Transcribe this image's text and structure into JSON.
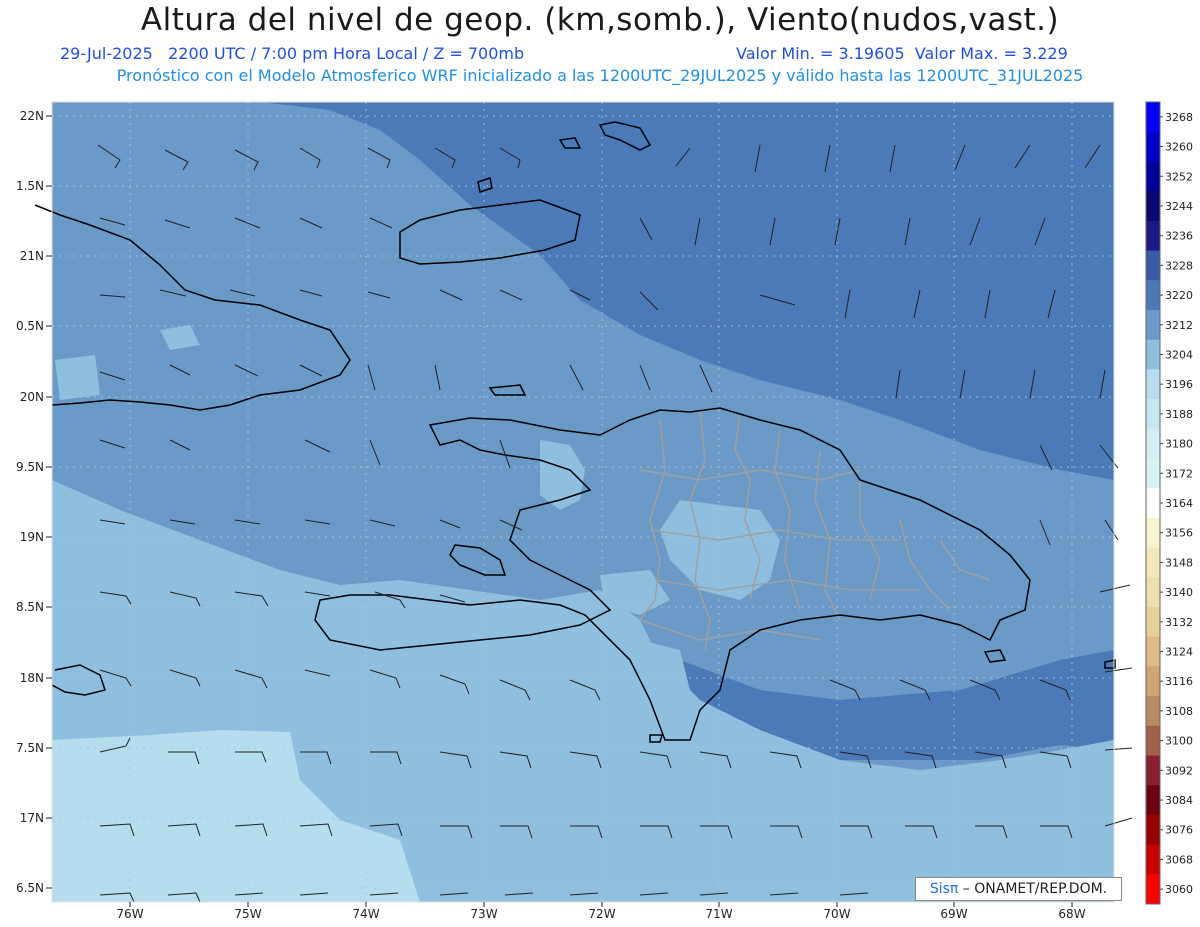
{
  "header": {
    "title": "Altura del nivel de geop. (km,somb.), Viento(nudos,vast.)",
    "run_line": "29-Jul-2025   2200 UTC / 7:00 pm Hora Local / Z = 700mb",
    "minmax_line": "Valor Min. = 3.19605  Valor Max. = 3.229",
    "model_line": "Pronóstico con el Modelo Atmosferico WRF inicializado a las 1200UTC_29JUL2025 y válido hasta las  1200UTC_31JUL2025"
  },
  "axes": {
    "lat_labels": [
      "22N",
      "1.5N",
      "21N",
      "0.5N",
      "20N",
      "9.5N",
      "19N",
      "8.5N",
      "18N",
      "7.5N",
      "17N",
      "6.5N"
    ],
    "lon_labels": [
      "76W",
      "75W",
      "74W",
      "73W",
      "72W",
      "71W",
      "70W",
      "69W",
      "68W"
    ]
  },
  "colorbar": {
    "labels": [
      "3268",
      "3260",
      "3252",
      "3244",
      "3236",
      "3228",
      "3220",
      "3212",
      "3204",
      "3196",
      "3188",
      "3180",
      "3172",
      "3164",
      "3156",
      "3148",
      "3140",
      "3132",
      "3124",
      "3116",
      "3108",
      "3100",
      "3092",
      "3084",
      "3076",
      "3068",
      "3060"
    ],
    "colors": [
      "#0000ff",
      "#0000cc",
      "#000099",
      "#0a0a70",
      "#1a1a88",
      "#3a5aa8",
      "#4a7ab8",
      "#6a9ac8",
      "#8ebfdf",
      "#b5dded",
      "#c5e8f0",
      "#d3eef4",
      "#d8f3f6",
      "#ffffff",
      "#f8f3cc",
      "#f3e8bb",
      "#eedfaa",
      "#e6d09a",
      "#dcbb85",
      "#cea472",
      "#b88a60",
      "#a0604a",
      "#882030",
      "#700010",
      "#990000",
      "#cc0000",
      "#ff0000"
    ]
  },
  "palette": {
    "ocean_dark": "#4a7ab8",
    "ocean_mid": "#6a9ac8",
    "ocean_light": "#8ebfdf",
    "ocean_lightest": "#b5dded",
    "coast": "#000000",
    "provinces": "#9a9a9a",
    "wind_barb": "#222222"
  },
  "credit": {
    "logo": "Sisπ",
    "text": " – ONAMET/REP.DOM."
  }
}
